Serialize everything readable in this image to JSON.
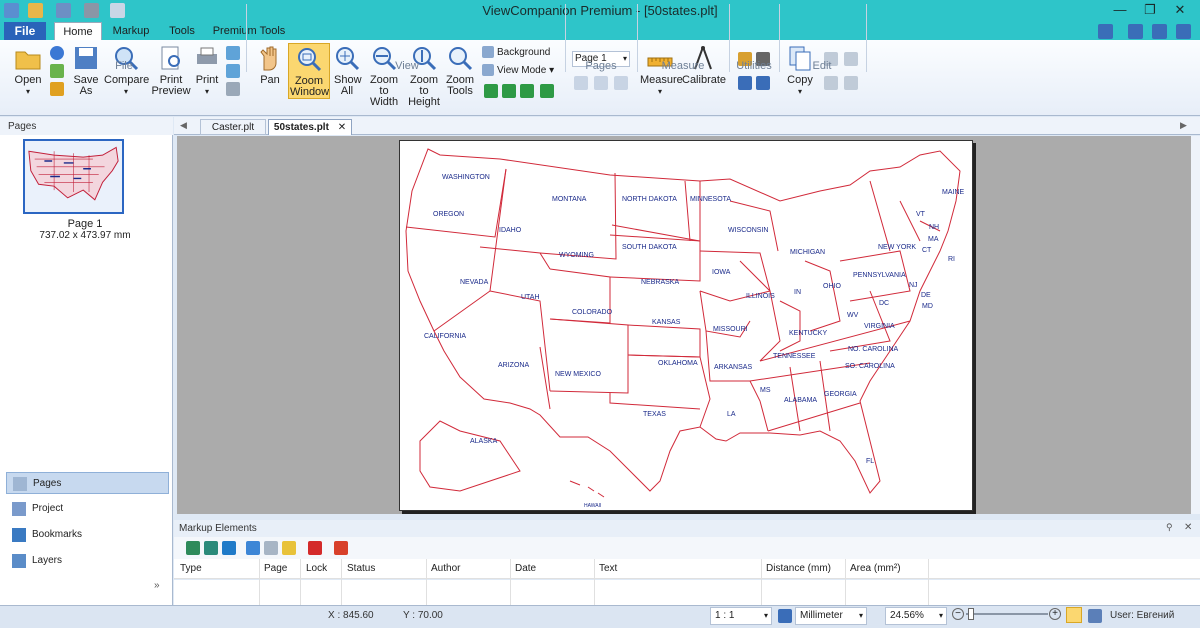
{
  "window": {
    "title": "ViewCompanion Premium - [50states.plt]"
  },
  "ribbon_tabs": [
    "File",
    "Home",
    "Markup",
    "Tools",
    "Premium Tools"
  ],
  "ribbon": {
    "file_group": {
      "label": "File",
      "open": "Open",
      "save_as": "Save As",
      "compare": "Compare",
      "print_preview": "Print Preview",
      "print": "Print"
    },
    "view_group": {
      "label": "View",
      "pan": "Pan",
      "zoom_window": "Zoom Window",
      "show_all": "Show All",
      "zoom_width": "Zoom to Width",
      "zoom_height": "Zoom to Height",
      "zoom_tools": "Zoom Tools",
      "background": "Background",
      "view_mode": "View Mode"
    },
    "pages_group": {
      "label": "Pages",
      "selected": "Page 1"
    },
    "measure_group": {
      "label": "Measure",
      "measure": "Measure",
      "calibrate": "Calibrate"
    },
    "utilities_group": {
      "label": "Utilities"
    },
    "edit_group": {
      "label": "Edit",
      "copy": "Copy"
    }
  },
  "left_panel": {
    "header": "Pages",
    "thumbnail": {
      "label": "Page 1",
      "size": "737.02 x 473.97 mm"
    },
    "nav": [
      "Pages",
      "Project",
      "Bookmarks",
      "Layers"
    ]
  },
  "doc_tabs": [
    "Caster.plt",
    "50states.plt"
  ],
  "map_labels": [
    "WASHINGTON",
    "OREGON",
    "IDAHO",
    "MONTANA",
    "NORTH DAKOTA",
    "MINNESOTA",
    "SOUTH DAKOTA",
    "WYOMING",
    "NEVADA",
    "UTAH",
    "COLORADO",
    "NEBRASKA",
    "IOWA",
    "WISCONSIN",
    "MICHIGAN",
    "NEW YORK",
    "PENNSYLVANIA",
    "OHIO",
    "IN",
    "ILLINOIS",
    "KANSAS",
    "MISSOURI",
    "KENTUCKY",
    "WV",
    "VIRGINIA",
    "CALIFORNIA",
    "ARIZONA",
    "NEW MEXICO",
    "OKLAHOMA",
    "ARKANSAS",
    "TENNESSEE",
    "NO. CAROLINA",
    "SO. CAROLINA",
    "MS",
    "ALABAMA",
    "GEORGIA",
    "TEXAS",
    "LA",
    "FL",
    "ALASKA",
    "HAWAII",
    "MAINE",
    "VT",
    "NH",
    "MA",
    "CT",
    "RI",
    "NJ",
    "DE",
    "MD",
    "DC"
  ],
  "markup": {
    "title": "Markup Elements",
    "columns": [
      "Type",
      "Page",
      "Lock",
      "Status",
      "Author",
      "Date",
      "Text",
      "Distance (mm)",
      "Area (mm²)"
    ]
  },
  "status": {
    "x": "X : 845.60",
    "y": "Y : 70.00",
    "scale": "1 : 1",
    "units": "Millimeter",
    "zoom": "24.56%",
    "user": "User: Евгений"
  }
}
